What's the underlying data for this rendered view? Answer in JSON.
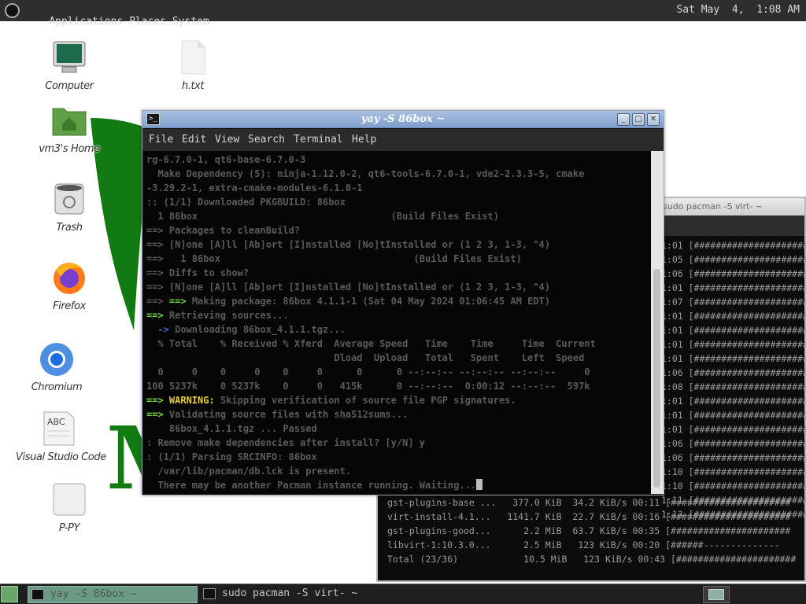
{
  "top_panel": {
    "menus": [
      "Applications",
      "Places",
      "System"
    ],
    "clock": "Sat May  4,  1:08 AM"
  },
  "desktop": {
    "icons": [
      {
        "name": "computer",
        "label": "Computer"
      },
      {
        "name": "text-file",
        "label": "h.txt"
      },
      {
        "name": "home-folder",
        "label": "vm3's Home"
      },
      {
        "name": "trash",
        "label": "Trash"
      },
      {
        "name": "firefox",
        "label": "Firefox"
      },
      {
        "name": "chromium",
        "label": "Chromium"
      },
      {
        "name": "vscode",
        "label": "Visual Studio Code"
      },
      {
        "name": "p-py",
        "label": "P-PY"
      }
    ],
    "wallpaper_letter": "M",
    "colors": {
      "wallpaper_green": "#127a12"
    }
  },
  "terminal_main": {
    "title": "yay -S 86box ~",
    "menu": [
      "File",
      "Edit",
      "View",
      "Search",
      "Terminal",
      "Help"
    ],
    "lines": [
      {
        "parts": [
          {
            "c": "d",
            "t": "rg-6.7.0-1, qt6-base-6.7.0-3"
          }
        ]
      },
      {
        "parts": [
          {
            "c": "d",
            "t": "  Make Dependency (5): ninja-1.12.0-2, qt6-tools-6.7.0-1, vde2-2.3.3-5, cmake"
          }
        ]
      },
      {
        "parts": [
          {
            "c": "d",
            "t": "-3.29.2-1, extra-cmake-modules-6.1.0-1"
          }
        ]
      },
      {
        "parts": [
          {
            "c": "d",
            "t": ":: (1/1) Downloaded PKGBUILD: 86box"
          }
        ]
      },
      {
        "parts": [
          {
            "c": "d",
            "t": "  1 86box                                  (Build Files Exist)"
          }
        ]
      },
      {
        "parts": [
          {
            "c": "d",
            "t": "==> Packages to cleanBuild?"
          }
        ]
      },
      {
        "parts": [
          {
            "c": "d",
            "t": "==> [N]one [A]ll [Ab]ort [I]nstalled [No]tInstalled or (1 2 3, 1-3, ^4)"
          }
        ]
      },
      {
        "parts": [
          {
            "c": "d",
            "t": "==>   1 86box                                  (Build Files Exist)"
          }
        ]
      },
      {
        "parts": [
          {
            "c": "d",
            "t": "==> Diffs to show?"
          }
        ]
      },
      {
        "parts": [
          {
            "c": "d",
            "t": "==> [N]one [A]ll [Ab]ort [I]nstalled [No]tInstalled or (1 2 3, 1-3, ^4)"
          }
        ]
      },
      {
        "parts": [
          {
            "c": "d",
            "t": "==> "
          },
          {
            "c": "g",
            "t": "==>"
          },
          {
            "c": "d",
            "t": " Making package: 86box 4.1.1-1 (Sat 04 May 2024 01:06:45 AM EDT)"
          }
        ]
      },
      {
        "parts": [
          {
            "c": "g",
            "t": "==>"
          },
          {
            "c": "d",
            "t": " Retrieving sources..."
          }
        ]
      },
      {
        "parts": [
          {
            "c": "b",
            "t": "  ->"
          },
          {
            "c": "d",
            "t": " Downloading 86box_4.1.1.tgz..."
          }
        ]
      },
      {
        "parts": [
          {
            "c": "d",
            "t": "  % Total    % Received % Xferd  Average Speed   Time    Time     Time  Current"
          }
        ]
      },
      {
        "parts": [
          {
            "c": "d",
            "t": "                                 Dload  Upload   Total   Spent    Left  Speed"
          }
        ]
      },
      {
        "parts": [
          {
            "c": "d",
            "t": "  0     0    0     0    0     0      0      0 --:--:-- --:--:-- --:--:--     0"
          }
        ]
      },
      {
        "parts": [
          {
            "c": "d",
            "t": "100 5237k    0 5237k    0     0   415k      0 --:--:--  0:00:12 --:--:--  597k"
          }
        ]
      },
      {
        "parts": [
          {
            "c": "g",
            "t": "==>"
          },
          {
            "c": "y",
            "t": " WARNING:"
          },
          {
            "c": "d",
            "t": " Skipping verification of source file PGP signatures."
          }
        ]
      },
      {
        "parts": [
          {
            "c": "g",
            "t": "==>"
          },
          {
            "c": "d",
            "t": " Validating source files with sha512sums..."
          }
        ]
      },
      {
        "parts": [
          {
            "c": "d",
            "t": "    86box_4.1.1.tgz ... Passed"
          }
        ]
      },
      {
        "parts": [
          {
            "c": "d",
            "t": ": Remove make dependencies after install? [y/N] y"
          }
        ]
      },
      {
        "parts": [
          {
            "c": "d",
            "t": ": (1/1) Parsing SRCINFO: 86box"
          }
        ]
      },
      {
        "parts": [
          {
            "c": "d",
            "t": "  /var/lib/pacman/db.lck is present."
          }
        ]
      },
      {
        "parts": [
          {
            "c": "d",
            "t": "  There may be another Pacman instance running. Waiting..."
          },
          {
            "c": "cursor",
            "t": ""
          }
        ]
      }
    ]
  },
  "terminal_back": {
    "title": "sudo pacman -S virt- ~",
    "right_col": [
      "1:01 [######################",
      "1:05 [######################",
      "1:06 [######################",
      "1:01 [######################",
      "1:07 [######################",
      "1:01 [######################",
      "1:01 [######################",
      "1:01 [######################",
      "1:01 [######################",
      "1:06 [######################",
      "1:08 [######################",
      "1:01 [######################",
      "1:01 [######################",
      "1:01 [######################",
      "1:06 [######################",
      "1:06 [######################",
      "1:10 [######################",
      "1:10 [######################",
      "1:11 [######################",
      "1:13 [######################"
    ],
    "bottom_lines": [
      "gst-plugins-base ...   377.0 KiB  34.2 KiB/s 00:11 [######################",
      "virt-install-4.1...   1141.7 KiB  22.7 KiB/s 00:16 [######################",
      "gst-plugins-good...      2.2 MiB  63.7 KiB/s 00:35 [######################",
      "libvirt-1:10.3.0...      2.5 MiB   123 KiB/s 00:20 [######--------------",
      "Total (23/36)            10.5 MiB   123 KiB/s 00:43 [######################"
    ]
  },
  "taskbar": {
    "tasks": [
      {
        "label": "yay -S 86box ~",
        "active": true
      },
      {
        "label": "sudo pacman -S virt- ~",
        "active": false
      }
    ]
  }
}
